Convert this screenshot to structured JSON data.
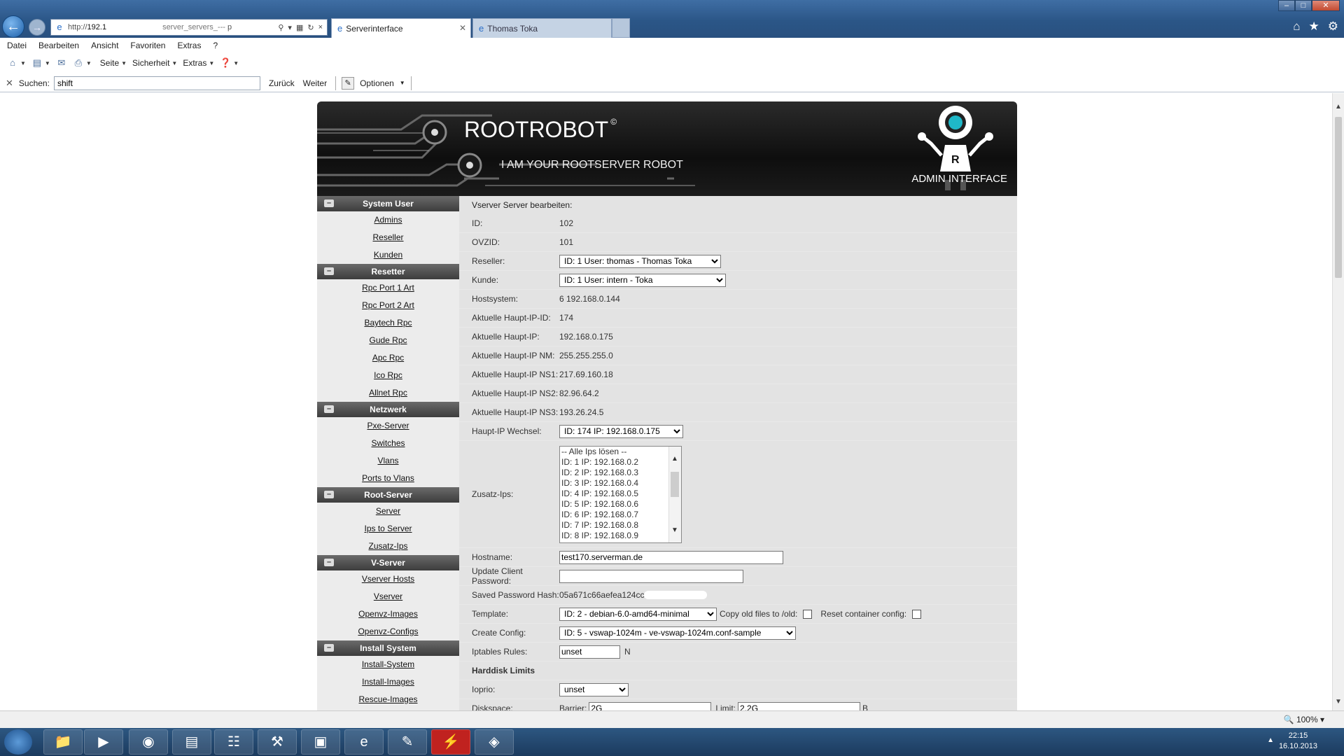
{
  "browser": {
    "address": {
      "prefix": "http://",
      "host": "192.1",
      "mid": "server_servers_---",
      "suffix": "p"
    },
    "tabs": [
      {
        "label": "Serverinterface"
      },
      {
        "label": "Thomas Toka"
      }
    ],
    "menu": [
      "Datei",
      "Bearbeiten",
      "Ansicht",
      "Favoriten",
      "Extras",
      "?"
    ],
    "commands": {
      "seite": "Seite",
      "sicherheit": "Sicherheit",
      "extras": "Extras"
    },
    "find": {
      "label": "Suchen:",
      "value": "shift",
      "back": "Zurück",
      "next": "Weiter",
      "options": "Optionen"
    },
    "zoom": "100%"
  },
  "banner": {
    "title": "ROOTROBOT",
    "copyright": "©",
    "subtitle": "I AM YOUR ROOTSERVER ROBOT",
    "admin": "ADMIN INTERFACE",
    "robot_letter": "R"
  },
  "sidebar": [
    {
      "category": "System User",
      "links": [
        "Admins",
        "Reseller",
        "Kunden"
      ]
    },
    {
      "category": "Resetter",
      "links": [
        "Rpc Port 1 Art",
        "Rpc Port 2 Art",
        "Baytech Rpc",
        "Gude Rpc",
        "Apc Rpc",
        "Ico Rpc",
        "Allnet Rpc"
      ]
    },
    {
      "category": "Netzwerk",
      "links": [
        "Pxe-Server",
        "Switches",
        "Vlans",
        "Ports to Vlans"
      ]
    },
    {
      "category": "Root-Server",
      "links": [
        "Server",
        "Ips to Server",
        "Zusatz-Ips"
      ]
    },
    {
      "category": "V-Server",
      "links": [
        "Vserver Hosts",
        "Vserver",
        "Openvz-Images",
        "Openvz-Configs"
      ]
    },
    {
      "category": "Install System",
      "links": [
        "Install-System",
        "Install-Images",
        "Rescue-Images"
      ]
    }
  ],
  "form": {
    "heading": "Vserver Server bearbeiten:",
    "id": {
      "label": "ID:",
      "value": "102"
    },
    "ovzid": {
      "label": "OVZID:",
      "value": "101"
    },
    "reseller": {
      "label": "Reseller:",
      "value": "ID: 1 User: thomas - Thomas Toka"
    },
    "kunde": {
      "label": "Kunde:",
      "value": "ID: 1 User: intern - Toka"
    },
    "hostsystem": {
      "label": "Hostsystem:",
      "value": "6 192.168.0.144"
    },
    "haupt_ip_id": {
      "label": "Aktuelle Haupt-IP-ID:",
      "value": "174"
    },
    "haupt_ip": {
      "label": "Aktuelle Haupt-IP:",
      "value": "192.168.0.175"
    },
    "haupt_ip_nm": {
      "label": "Aktuelle Haupt-IP NM:",
      "value": "255.255.255.0"
    },
    "ns1": {
      "label": "Aktuelle Haupt-IP NS1:",
      "value": "217.69.160.18"
    },
    "ns2": {
      "label": "Aktuelle Haupt-IP NS2:",
      "value": "82.96.64.2"
    },
    "ns3": {
      "label": "Aktuelle Haupt-IP NS3:",
      "value": "193.26.24.5"
    },
    "haupt_ip_wechsel": {
      "label": "Haupt-IP Wechsel:",
      "value": "ID: 174 IP: 192.168.0.175"
    },
    "zusatz_ips": {
      "label": "Zusatz-Ips:",
      "options": [
        "-- Alle Ips lösen --",
        "ID: 1 IP: 192.168.0.2",
        "ID: 2 IP: 192.168.0.3",
        "ID: 3 IP: 192.168.0.4",
        "ID: 4 IP: 192.168.0.5",
        "ID: 5 IP: 192.168.0.6",
        "ID: 6 IP: 192.168.0.7",
        "ID: 7 IP: 192.168.0.8",
        "ID: 8 IP: 192.168.0.9"
      ]
    },
    "hostname": {
      "label": "Hostname:",
      "value": "test170.serverman.de"
    },
    "update_pw": {
      "label": "Update Client Password:",
      "value": ""
    },
    "saved_hash": {
      "label": "Saved Password Hash:",
      "value": "05a671c66aefea124cc08"
    },
    "template": {
      "label": "Template:",
      "value": "ID: 2 - debian-6.0-amd64-minimal",
      "copy_old": "Copy old files to /old:",
      "reset": "Reset container config:"
    },
    "create_config": {
      "label": "Create Config:",
      "value": "ID: 5 - vswap-1024m - ve-vswap-1024m.conf-sample"
    },
    "iptables": {
      "label": "Iptables Rules:",
      "value": "unset",
      "suffix": "N"
    },
    "hdd_heading": "Harddisk Limits",
    "ioprio": {
      "label": "Ioprio:",
      "value": "unset"
    },
    "diskspace": {
      "label": "Diskspace:",
      "barrier_label": "Barrier:",
      "barrier": "2G",
      "limit_label": "Limit:",
      "limit": "2.2G",
      "unit": "B"
    }
  },
  "taskbar": {
    "time": "22:15",
    "date": "16.10.2013"
  }
}
